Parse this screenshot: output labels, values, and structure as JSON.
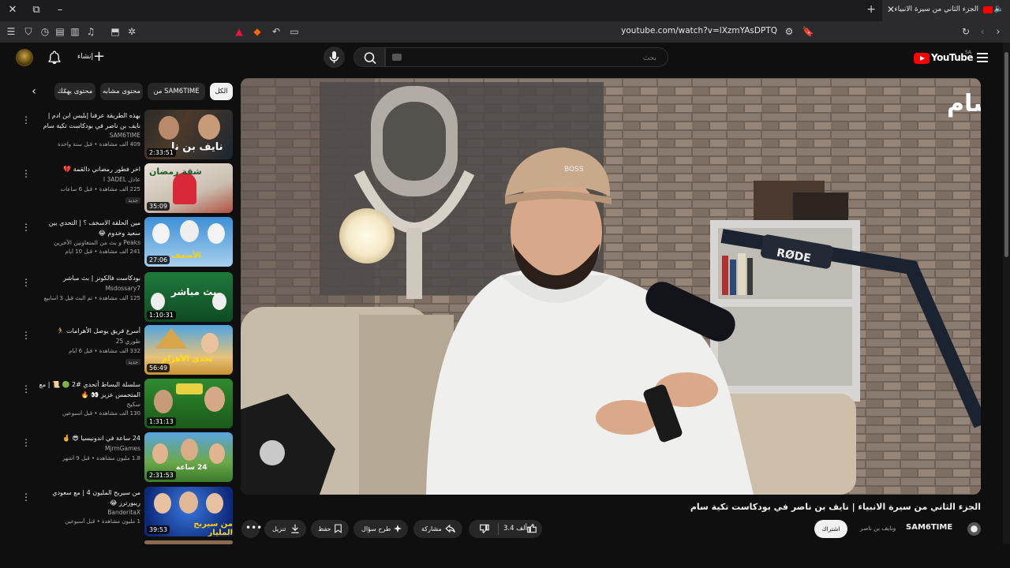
{
  "browser": {
    "tab_title": "الجزء الثاني من سيرة الانبياء | نايف",
    "url": "youtube.com/watch?v=lXzmYAsDPTQ"
  },
  "header": {
    "create_label": "إنشاء",
    "search_placeholder": "بحث",
    "logo_text": "YouTube",
    "logo_country": "SA"
  },
  "chips": [
    {
      "label": "الكل",
      "active": true
    },
    {
      "label": "من SAM6TIME",
      "active": false
    },
    {
      "label": "محتوى مشابه",
      "active": false
    },
    {
      "label": "محتوى يهمّك",
      "active": false
    }
  ],
  "recommendations": [
    {
      "title": "بهذه الطريقة عرفنا إبليس ابن ادم | نايف بن ناصر في بودكاست تكية سام",
      "channel": "SAM6TIME",
      "meta": "409 ألف مشاهدة • قبل سنة واحدة",
      "duration": "2:33:51",
      "new": false
    },
    {
      "title": "اخر فطور رمضاني دالقمة 💔",
      "channel": "عادل I 3ADEL",
      "meta": "225 ألف مشاهدة • قبل 6 ساعات",
      "duration": "35:09",
      "new": true
    },
    {
      "title": "مين الحلقة الاسخف ؟ | التحدي بين سعيد وخدوم 😂",
      "channel": "Peaks و بث من المتعاونين الآخرين",
      "meta": "241 ألف مشاهدة • قبل 10 أيام",
      "duration": "27:06",
      "new": false
    },
    {
      "title": "بودكاست فالكونز | بث مباشر",
      "channel": "Msdossary7",
      "meta": "125 ألف مشاهدة • تم البث قبل 3 أسابيع",
      "duration": "1:10:31",
      "new": false
    },
    {
      "title": "أسرع فريق يوصل الأهرامات 🏃",
      "channel": "طوري 25",
      "meta": "332 ألف مشاهدة • قبل 6 أيام",
      "duration": "56:49",
      "new": true
    },
    {
      "title": "سلسلة البساط أتحدي #2 🟢 📜 | مع المتحمس عزيز 👀 🔥",
      "channel": "سكيج",
      "meta": "130 ألف مشاهدة • قبل أسبوعين",
      "duration": "1:31:13",
      "new": false
    },
    {
      "title": "24 ساعة في اندونيسيا 😎 🤞",
      "channel": "MjrmGames",
      "meta": "1.8 مليون مشاهدة • قبل 9 أشهر",
      "duration": "2:31:53",
      "new": false
    },
    {
      "title": "من سيربح المليون 4 | مع سعودي ريبورترز 😂",
      "channel": "BanderitaX",
      "meta": "1 مليون مشاهدة • قبل أسبوعين",
      "duration": "39:53",
      "new": false
    }
  ],
  "thumb_texts": [
    "نايف بن نا",
    "شقة رمضان",
    "الأضعف",
    "بث مباشر",
    "تحدي الأهرام",
    "",
    "24 ساعة",
    "من سيربح المليار"
  ],
  "video": {
    "title": "الجزء الثاني من سيرة الانبياء | نايف بن ناصر في بودكاست تكية سام",
    "watermark": "تكية سام",
    "mic_brand": "RØDE",
    "cap_brand": "BOSS"
  },
  "channel": {
    "name": "SAM6TIME",
    "collab": "ونايف بن ناصر",
    "subscribe_label": "اشتراك"
  },
  "actions": {
    "likes": "3.4 ألف",
    "share": "مشاركة",
    "ask": "طرح سؤال",
    "save": "حفظ",
    "download": "تنزيل"
  },
  "colors": {
    "background": "#0f0f0f",
    "accent": "#ff0000",
    "chip": "#272727"
  }
}
